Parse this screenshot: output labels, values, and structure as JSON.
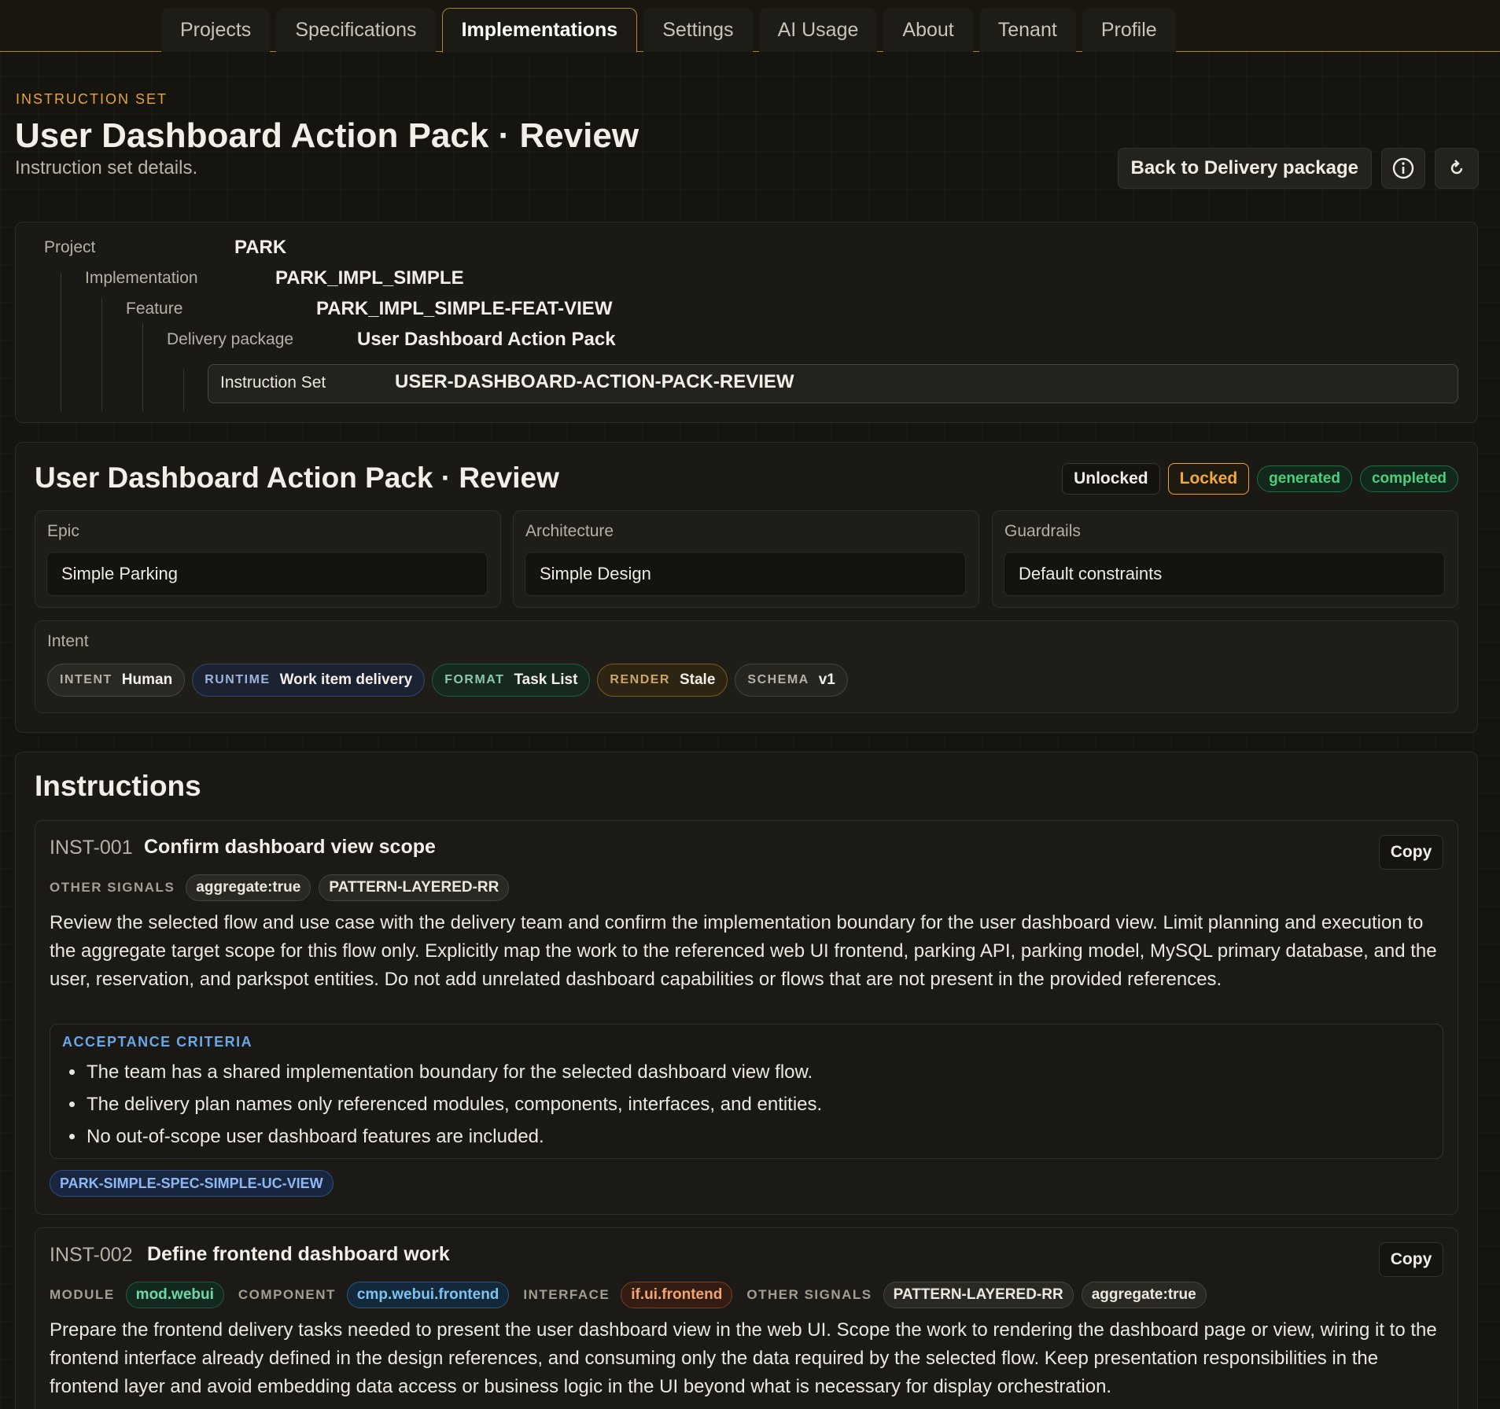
{
  "nav": {
    "tabs": [
      "Projects",
      "Specifications",
      "Implementations",
      "Settings",
      "AI Usage",
      "About",
      "Tenant",
      "Profile"
    ],
    "active": "Implementations"
  },
  "header": {
    "eyebrow": "INSTRUCTION SET",
    "title": "User Dashboard Action Pack · Review",
    "subtitle": "Instruction set details.",
    "back_label": "Back to Delivery package",
    "info_icon": "info-icon",
    "refresh_icon": "refresh-icon",
    "info_glyph": "ⓘ",
    "refresh_glyph": "↻"
  },
  "breadcrumb": [
    {
      "label": "Project",
      "value": "PARK"
    },
    {
      "label": "Implementation",
      "value": "PARK_IMPL_SIMPLE"
    },
    {
      "label": "Feature",
      "value": "PARK_IMPL_SIMPLE-FEAT-VIEW"
    },
    {
      "label": "Delivery package",
      "value": "User Dashboard Action Pack"
    },
    {
      "label": "Instruction Set",
      "value": "USER-DASHBOARD-ACTION-PACK-REVIEW"
    }
  ],
  "summary": {
    "title": "User Dashboard Action Pack · Review",
    "badges": {
      "unlocked": "Unlocked",
      "locked": "Locked",
      "generated": "generated",
      "completed": "completed"
    },
    "fields": [
      {
        "label": "Epic",
        "value": "Simple Parking"
      },
      {
        "label": "Architecture",
        "value": "Simple Design"
      },
      {
        "label": "Guardrails",
        "value": "Default constraints"
      }
    ],
    "intent_label": "Intent",
    "intent_chips": [
      {
        "key": "INTENT",
        "value": "Human"
      },
      {
        "key": "RUNTIME",
        "value": "Work item delivery"
      },
      {
        "key": "FORMAT",
        "value": "Task List"
      },
      {
        "key": "RENDER",
        "value": "Stale"
      },
      {
        "key": "SCHEMA",
        "value": "v1"
      }
    ]
  },
  "instructions": {
    "heading": "Instructions",
    "copy_label": "Copy",
    "items": [
      {
        "id": "INST-001",
        "title": "Confirm dashboard view scope",
        "other_signals_label": "OTHER SIGNALS",
        "other_signals": [
          "aggregate:true",
          "PATTERN-LAYERED-RR"
        ],
        "body": "Review the selected flow and use case with the delivery team and confirm the implementation boundary for the user dashboard view. Limit planning and execution to the aggregate target scope for this flow only. Explicitly map the work to the referenced web UI frontend, parking API, parking model, MySQL primary database, and the user, reservation, and parkspot entities. Do not add unrelated dashboard capabilities or flows that are not present in the provided references.",
        "acceptance_label": "ACCEPTANCE CRITERIA",
        "acceptance": [
          "The team has a shared implementation boundary for the selected dashboard view flow.",
          "The delivery plan names only referenced modules, components, interfaces, and entities.",
          "No out-of-scope user dashboard features are included."
        ],
        "reference": "PARK-SIMPLE-SPEC-SIMPLE-UC-VIEW"
      },
      {
        "id": "INST-002",
        "title": "Define frontend dashboard work",
        "module_label": "MODULE",
        "module": "mod.webui",
        "component_label": "COMPONENT",
        "component": "cmp.webui.frontend",
        "interface_label": "INTERFACE",
        "interface": "if.ui.frontend",
        "other_signals_label": "OTHER SIGNALS",
        "other_signals": [
          "PATTERN-LAYERED-RR",
          "aggregate:true"
        ],
        "body": "Prepare the frontend delivery tasks needed to present the user dashboard view in the web UI. Scope the work to rendering the dashboard page or view, wiring it to the frontend interface already defined in the design references, and consuming only the data required by the selected flow. Keep presentation responsibilities in the frontend layer and avoid embedding data access or business logic in the UI beyond what is necessary for display orchestration."
      }
    ]
  }
}
